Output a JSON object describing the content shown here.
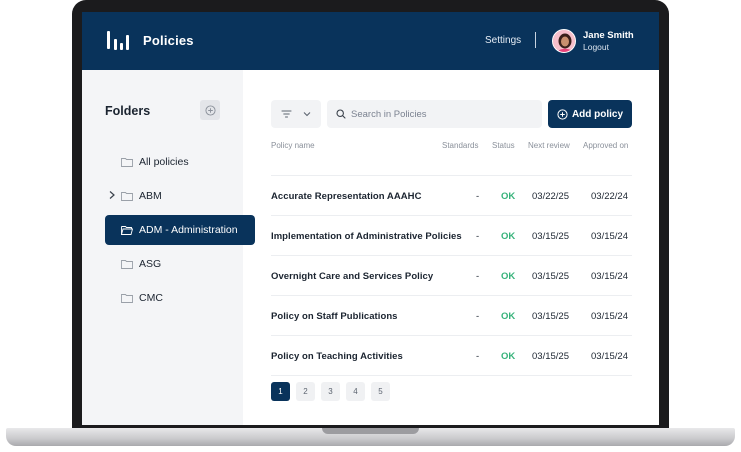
{
  "header": {
    "app_title": "Policies",
    "settings_label": "Settings",
    "user_name": "Jane Smith",
    "logout_label": "Logout",
    "brand_color": "#09335b",
    "logo_icon": "bars-logo-icon"
  },
  "sidebar": {
    "title": "Folders",
    "add_icon": "plus-circle-icon",
    "folders": [
      {
        "label": "All policies",
        "expandable": false,
        "active": false
      },
      {
        "label": "ABM",
        "expandable": true,
        "active": false
      },
      {
        "label": "ADM - Administration",
        "expandable": false,
        "active": true
      },
      {
        "label": "ASG",
        "expandable": false,
        "active": false
      },
      {
        "label": "CMC",
        "expandable": false,
        "active": false
      }
    ]
  },
  "toolbar": {
    "filter_icon": "filter-icon",
    "search_placeholder": "Search in Policies",
    "add_label": "Add policy"
  },
  "table": {
    "columns": [
      "Policy name",
      "Standards",
      "Status",
      "Next review",
      "Approved on"
    ],
    "rows": [
      {
        "name": "Accurate Representation AAAHC",
        "standards": "-",
        "status": "OK",
        "next_review": "03/22/25",
        "approved_on": "03/22/24"
      },
      {
        "name": "Implementation of Administrative Policies",
        "standards": "-",
        "status": "OK",
        "next_review": "03/15/25",
        "approved_on": "03/15/24"
      },
      {
        "name": "Overnight Care and Services Policy",
        "standards": "-",
        "status": "OK",
        "next_review": "03/15/25",
        "approved_on": "03/15/24"
      },
      {
        "name": "Policy on Staff Publications",
        "standards": "-",
        "status": "OK",
        "next_review": "03/15/25",
        "approved_on": "03/15/24"
      },
      {
        "name": "Policy on Teaching Activities",
        "standards": "-",
        "status": "OK",
        "next_review": "03/15/25",
        "approved_on": "03/15/24"
      }
    ],
    "status_color": "#36b27a"
  },
  "pagination": {
    "pages": [
      "1",
      "2",
      "3",
      "4",
      "5"
    ],
    "current": "1"
  }
}
